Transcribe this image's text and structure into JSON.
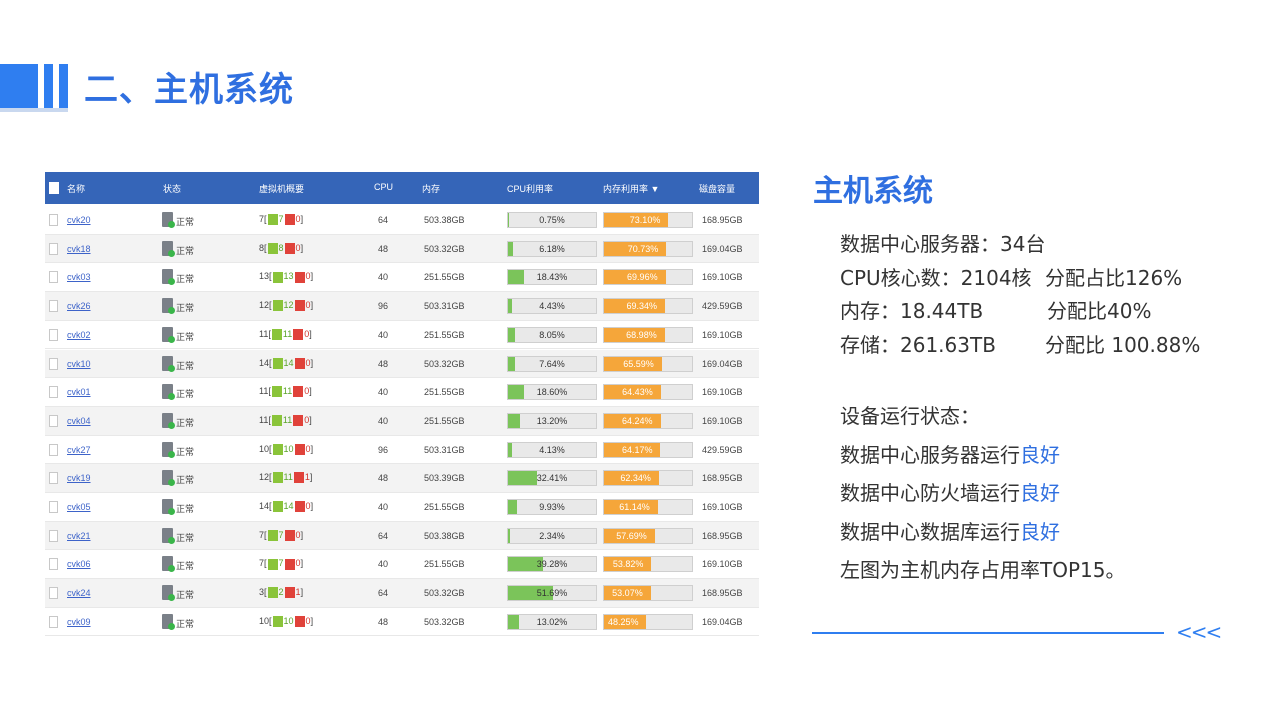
{
  "header": {
    "title": "二、主机系统"
  },
  "table": {
    "columns": [
      "名称",
      "状态",
      "虚拟机概要",
      "CPU",
      "内存",
      "CPU利用率",
      "内存利用率 ▼",
      "磁盘容量"
    ],
    "rows": [
      {
        "name": "cvk20",
        "status": "正常",
        "vm_total": "7",
        "vm_on": "7",
        "vm_off": "0",
        "cpu": "64",
        "memory": "503.38GB",
        "cpu_util": "0.75%",
        "cpu_pct": 0.75,
        "mem_util": "73.10%",
        "mem_pct": 73.1,
        "disk": "168.95GB"
      },
      {
        "name": "cvk18",
        "status": "正常",
        "vm_total": "8",
        "vm_on": "8",
        "vm_off": "0",
        "cpu": "48",
        "memory": "503.32GB",
        "cpu_util": "6.18%",
        "cpu_pct": 6.18,
        "mem_util": "70.73%",
        "mem_pct": 70.73,
        "disk": "169.04GB"
      },
      {
        "name": "cvk03",
        "status": "正常",
        "vm_total": "13",
        "vm_on": "13",
        "vm_off": "0",
        "cpu": "40",
        "memory": "251.55GB",
        "cpu_util": "18.43%",
        "cpu_pct": 18.43,
        "mem_util": "69.96%",
        "mem_pct": 69.96,
        "disk": "169.10GB"
      },
      {
        "name": "cvk26",
        "status": "正常",
        "vm_total": "12",
        "vm_on": "12",
        "vm_off": "0",
        "cpu": "96",
        "memory": "503.31GB",
        "cpu_util": "4.43%",
        "cpu_pct": 4.43,
        "mem_util": "69.34%",
        "mem_pct": 69.34,
        "disk": "429.59GB"
      },
      {
        "name": "cvk02",
        "status": "正常",
        "vm_total": "11",
        "vm_on": "11",
        "vm_off": "0",
        "cpu": "40",
        "memory": "251.55GB",
        "cpu_util": "8.05%",
        "cpu_pct": 8.05,
        "mem_util": "68.98%",
        "mem_pct": 68.98,
        "disk": "169.10GB"
      },
      {
        "name": "cvk10",
        "status": "正常",
        "vm_total": "14",
        "vm_on": "14",
        "vm_off": "0",
        "cpu": "48",
        "memory": "503.32GB",
        "cpu_util": "7.64%",
        "cpu_pct": 7.64,
        "mem_util": "65.59%",
        "mem_pct": 65.59,
        "disk": "169.04GB"
      },
      {
        "name": "cvk01",
        "status": "正常",
        "vm_total": "11",
        "vm_on": "11",
        "vm_off": "0",
        "cpu": "40",
        "memory": "251.55GB",
        "cpu_util": "18.60%",
        "cpu_pct": 18.6,
        "mem_util": "64.43%",
        "mem_pct": 64.43,
        "disk": "169.10GB"
      },
      {
        "name": "cvk04",
        "status": "正常",
        "vm_total": "11",
        "vm_on": "11",
        "vm_off": "0",
        "cpu": "40",
        "memory": "251.55GB",
        "cpu_util": "13.20%",
        "cpu_pct": 13.2,
        "mem_util": "64.24%",
        "mem_pct": 64.24,
        "disk": "169.10GB"
      },
      {
        "name": "cvk27",
        "status": "正常",
        "vm_total": "10",
        "vm_on": "10",
        "vm_off": "0",
        "cpu": "96",
        "memory": "503.31GB",
        "cpu_util": "4.13%",
        "cpu_pct": 4.13,
        "mem_util": "64.17%",
        "mem_pct": 64.17,
        "disk": "429.59GB"
      },
      {
        "name": "cvk19",
        "status": "正常",
        "vm_total": "12",
        "vm_on": "11",
        "vm_off": "1",
        "cpu": "48",
        "memory": "503.39GB",
        "cpu_util": "32.41%",
        "cpu_pct": 32.41,
        "mem_util": "62.34%",
        "mem_pct": 62.34,
        "disk": "168.95GB"
      },
      {
        "name": "cvk05",
        "status": "正常",
        "vm_total": "14",
        "vm_on": "14",
        "vm_off": "0",
        "cpu": "40",
        "memory": "251.55GB",
        "cpu_util": "9.93%",
        "cpu_pct": 9.93,
        "mem_util": "61.14%",
        "mem_pct": 61.14,
        "disk": "169.10GB"
      },
      {
        "name": "cvk21",
        "status": "正常",
        "vm_total": "7",
        "vm_on": "7",
        "vm_off": "0",
        "cpu": "64",
        "memory": "503.38GB",
        "cpu_util": "2.34%",
        "cpu_pct": 2.34,
        "mem_util": "57.69%",
        "mem_pct": 57.69,
        "disk": "168.95GB"
      },
      {
        "name": "cvk06",
        "status": "正常",
        "vm_total": "7",
        "vm_on": "7",
        "vm_off": "0",
        "cpu": "40",
        "memory": "251.55GB",
        "cpu_util": "39.28%",
        "cpu_pct": 39.28,
        "mem_util": "53.82%",
        "mem_pct": 53.82,
        "disk": "169.10GB"
      },
      {
        "name": "cvk24",
        "status": "正常",
        "vm_total": "3",
        "vm_on": "2",
        "vm_off": "1",
        "cpu": "64",
        "memory": "503.32GB",
        "cpu_util": "51.69%",
        "cpu_pct": 51.69,
        "mem_util": "53.07%",
        "mem_pct": 53.07,
        "disk": "168.95GB"
      },
      {
        "name": "cvk09",
        "status": "正常",
        "vm_total": "10",
        "vm_on": "10",
        "vm_off": "0",
        "cpu": "48",
        "memory": "503.32GB",
        "cpu_util": "13.02%",
        "cpu_pct": 13.02,
        "mem_util": "48.25%",
        "mem_pct": 48.25,
        "disk": "169.04GB"
      }
    ]
  },
  "side": {
    "title": "主机系统",
    "stats": [
      {
        "left": "数据中心服务器：34台",
        "right": ""
      },
      {
        "left": "CPU核心数：2104核",
        "right": "分配占比126%"
      },
      {
        "left": "内存：18.44TB",
        "right": "分配比40%"
      },
      {
        "left": "存储：261.63TB",
        "right": "分配比 100.88%"
      }
    ],
    "status_heading": "设备运行状态：",
    "status_lines": [
      {
        "text": "数据中心服务器运行",
        "good": "良好"
      },
      {
        "text": "数据中心防火墙运行",
        "good": "良好"
      },
      {
        "text": "数据中心数据库运行",
        "good": "良好"
      }
    ],
    "note": "左图为主机内存占用率TOP15。",
    "arrows": "<<<"
  },
  "colors": {
    "accent": "#2f6fe0",
    "table_header": "#3565b8",
    "cpu_bar": "#7bc45a",
    "mem_bar": "#f5a63a"
  }
}
